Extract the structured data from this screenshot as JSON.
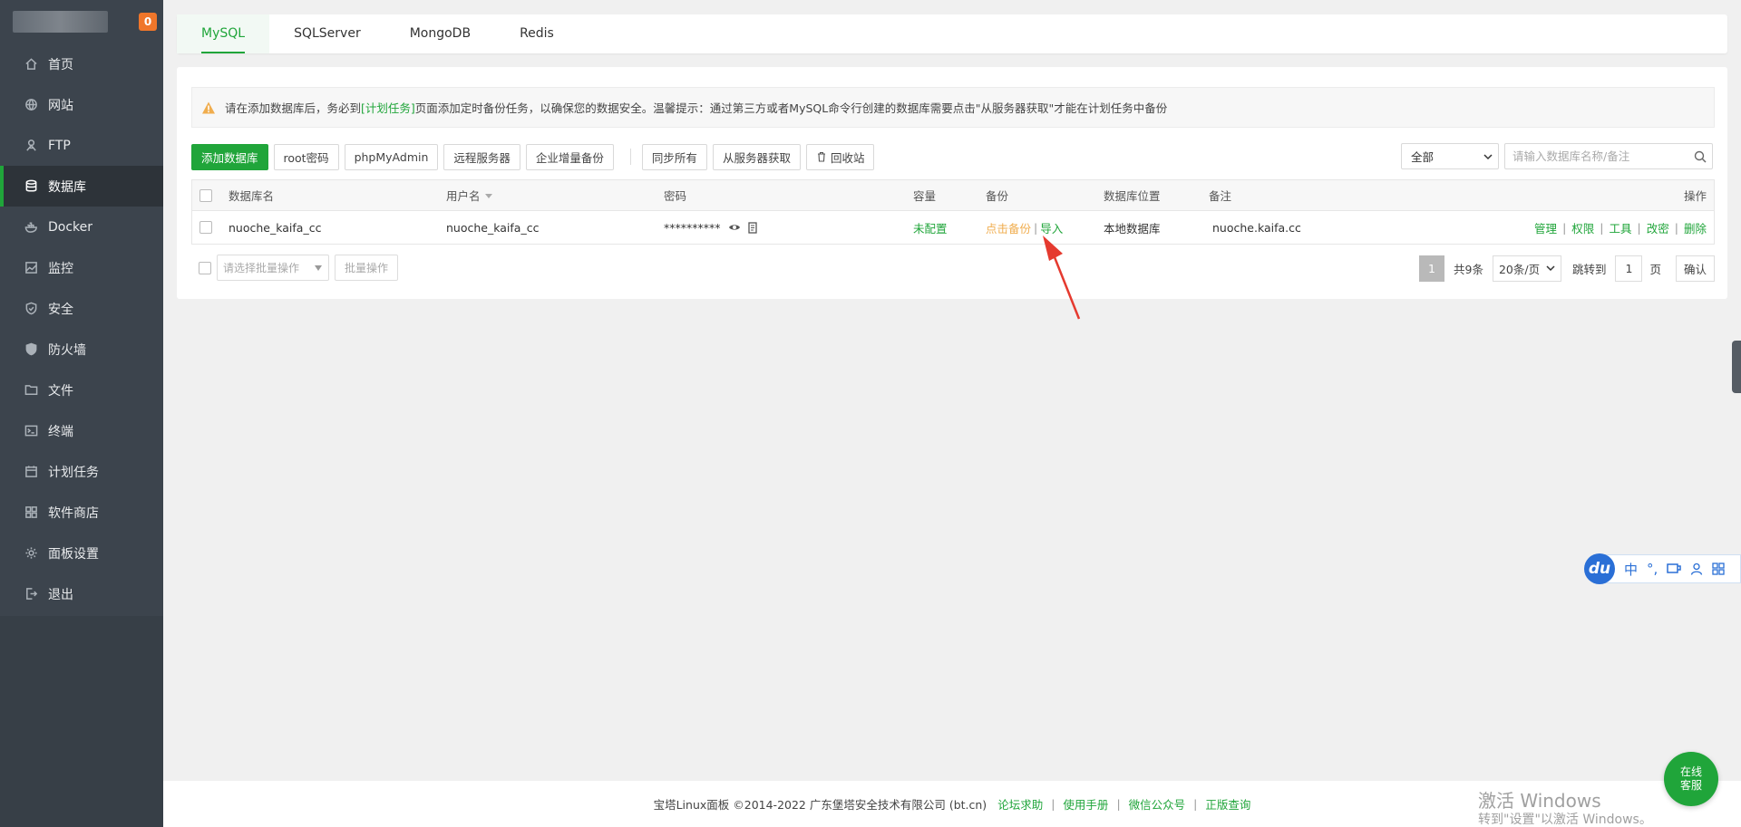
{
  "sidebar": {
    "badge": "0",
    "items": [
      {
        "label": "首页",
        "icon": "home-icon"
      },
      {
        "label": "网站",
        "icon": "globe-icon"
      },
      {
        "label": "FTP",
        "icon": "ftp-icon"
      },
      {
        "label": "数据库",
        "icon": "database-icon"
      },
      {
        "label": "Docker",
        "icon": "docker-icon"
      },
      {
        "label": "监控",
        "icon": "monitor-icon"
      },
      {
        "label": "安全",
        "icon": "shield-icon"
      },
      {
        "label": "防火墙",
        "icon": "firewall-icon"
      },
      {
        "label": "文件",
        "icon": "folder-icon"
      },
      {
        "label": "终端",
        "icon": "terminal-icon"
      },
      {
        "label": "计划任务",
        "icon": "calendar-icon"
      },
      {
        "label": "软件商店",
        "icon": "apps-icon"
      },
      {
        "label": "面板设置",
        "icon": "settings-icon"
      },
      {
        "label": "退出",
        "icon": "logout-icon"
      }
    ],
    "active": "数据库"
  },
  "tabs": [
    "MySQL",
    "SQLServer",
    "MongoDB",
    "Redis"
  ],
  "alert": {
    "prefix": "请在添加数据库后，务必到",
    "link": "[计划任务]",
    "suffix": "页面添加定时备份任务，以确保您的数据安全。温馨提示：通过第三方或者MySQL命令行创建的数据库需要点击\"从服务器获取\"才能在计划任务中备份"
  },
  "toolbar": {
    "add": "添加数据库",
    "root_pwd": "root密码",
    "phpmyadmin": "phpMyAdmin",
    "remote": "远程服务器",
    "enterprise_backup": "企业增量备份",
    "sync_all": "同步所有",
    "fetch": "从服务器获取",
    "recycle": "回收站"
  },
  "filter": {
    "select_value": "全部",
    "search_placeholder": "请输入数据库名称/备注"
  },
  "table": {
    "headers": {
      "name": "数据库名",
      "user": "用户名",
      "password": "密码",
      "capacity": "容量",
      "backup": "备份",
      "location": "数据库位置",
      "note": "备注",
      "ops": "操作"
    },
    "rows": [
      {
        "name": "nuoche_kaifa_cc",
        "user": "nuoche_kaifa_cc",
        "password": "**********",
        "capacity": "未配置",
        "backup_action": "点击备份",
        "import": "导入",
        "location": "本地数据库",
        "note": "nuoche.kaifa.cc",
        "ops": [
          "管理",
          "权限",
          "工具",
          "改密",
          "删除"
        ]
      }
    ]
  },
  "batch": {
    "placeholder": "请选择批量操作",
    "button": "批量操作"
  },
  "pager": {
    "current": "1",
    "total": "共9条",
    "page_size": "20条/页",
    "jump_label": "跳转到",
    "jump_value": "1",
    "page_unit": "页",
    "confirm": "确认"
  },
  "footer": {
    "copyright": "宝塔Linux面板 ©2014-2022 广东堡塔安全技术有限公司 (bt.cn)",
    "links": [
      "论坛求助",
      "使用手册",
      "微信公众号",
      "正版查询"
    ]
  },
  "ime": {
    "logo": "du",
    "lang": "中"
  },
  "chat": {
    "line1": "在线",
    "line2": "客服"
  },
  "watermark": {
    "title": "激活 Windows",
    "sub": "转到\"设置\"以激活 Windows。"
  },
  "colors": {
    "accent": "#20a53a",
    "sidebar": "#3c444d",
    "warning": "#f0ad4e",
    "badge": "#f0762a"
  }
}
